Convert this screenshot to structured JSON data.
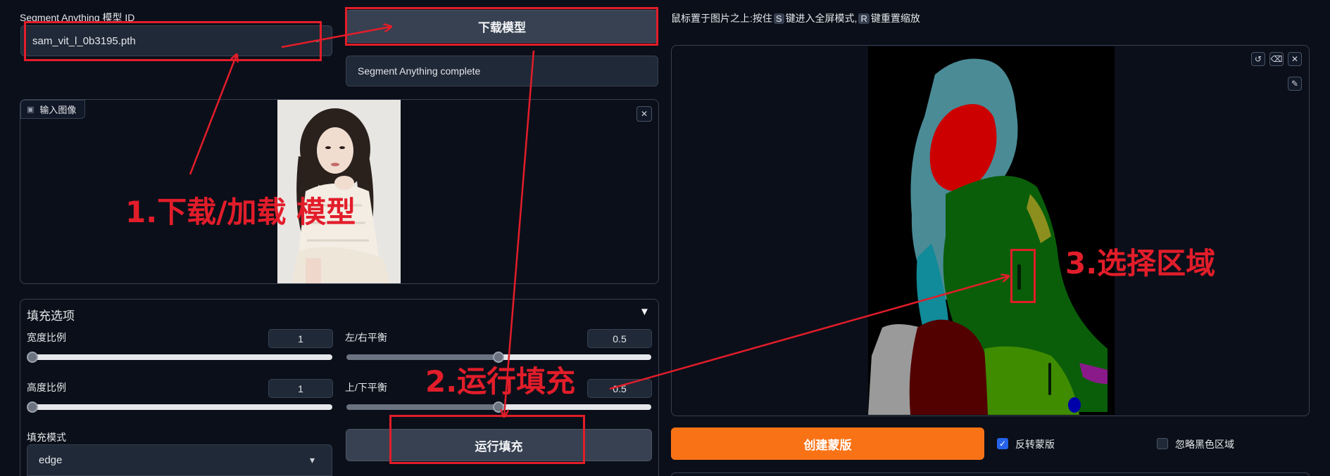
{
  "model": {
    "label": "Segment Anything 模型 ID",
    "selected": "sam_vit_l_0b3195.pth",
    "download_button": "下载模型",
    "status": "Segment Anything complete"
  },
  "input_image": {
    "label": "输入图像"
  },
  "fill_options": {
    "title": "填充选项",
    "toggle_icon": "▼",
    "width_ratio_label": "宽度比例",
    "width_ratio_value": "1",
    "width_ratio_level": 0.0,
    "lr_balance_label": "左/右平衡",
    "lr_balance_value": "0.5",
    "lr_balance_level": 0.5,
    "height_ratio_label": "高度比例",
    "height_ratio_value": "1",
    "height_ratio_level": 0.0,
    "tb_balance_label": "上/下平衡",
    "tb_balance_value": "0.5",
    "tb_balance_level": 0.5,
    "fill_mode_label": "填充模式",
    "fill_mode_value": "edge",
    "run_fill_button": "运行填充"
  },
  "segmentation": {
    "hint_prefix": "鼠标置于图片之上:按住",
    "hint_key_s": "S",
    "hint_middle": "键进入全屏模式,",
    "hint_key_r": "R",
    "hint_suffix": "键重置缩放",
    "create_mask_button": "创建蒙版",
    "invert_mask_label": "反转蒙版",
    "invert_mask_checked": true,
    "ignore_black_label": "忽略黑色区域",
    "ignore_black_checked": false
  },
  "annotations": {
    "step1": "1.下载/加载 模型",
    "step2": "2.运行填充",
    "step3": "3.选择区域"
  },
  "icons": {
    "close": "✕",
    "undo": "↺",
    "eraser": "⌫",
    "brush": "✎",
    "image": "▣",
    "dropdown": "▾"
  },
  "colors": {
    "accent_orange": "#f97316",
    "annotation_red": "#e21d2a",
    "checkbox_blue": "#2563eb"
  }
}
